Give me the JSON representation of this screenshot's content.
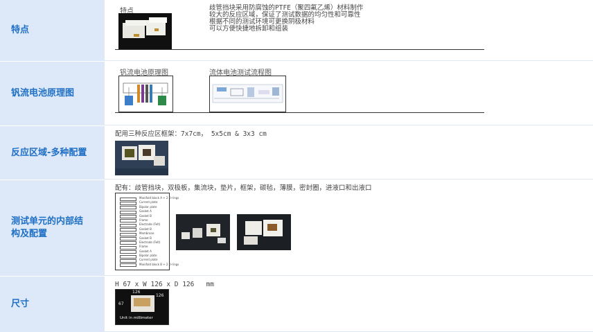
{
  "rows": [
    {
      "label": "特点",
      "image_caption": "特点",
      "features": [
        "歧管挡块采用防腐蚀的PTFE（聚四氟乙烯）材料制作",
        "较大的反应区域，保证了测试数据的均匀性和可靠性",
        "根据不同的测试环境可更换阴极材料",
        "可以方便快捷地拆卸和组装"
      ]
    },
    {
      "label": "钒流电池原理图",
      "diagram1_caption": "钒流电池原理图",
      "diagram2_caption": "流体电池测试流程图"
    },
    {
      "label": "反应区域-多种配置",
      "text": "配用三种反应区框架：7x7cm， 5x5cm & 3x3 cm"
    },
    {
      "label_line1": "测试单元的内部结",
      "label_line2": "构及配置",
      "text": "配有：歧管挡块，双极板，集流块，垫片，框架，碳毡，薄膜，密封圈，进液口和出液口",
      "parts": [
        "Manifold block A + 2 O-rings",
        "Current plate",
        "Bipolar plate",
        "Gasket A",
        "Gasket B",
        "Frame",
        "Electrode (Felt)",
        "Gasket B",
        "Membrane",
        "Gasket B",
        "Electrode (Felt)",
        "Frame",
        "Gasket A",
        "Bipolar plate",
        "Current plate",
        "Manifold block B + 2 O-rings"
      ]
    },
    {
      "label": "尺寸",
      "text": "H 67 x W 126 x D 126   mm",
      "dims": [
        "126",
        "126",
        "67"
      ],
      "unit_note": "Unit in millimeter"
    }
  ]
}
